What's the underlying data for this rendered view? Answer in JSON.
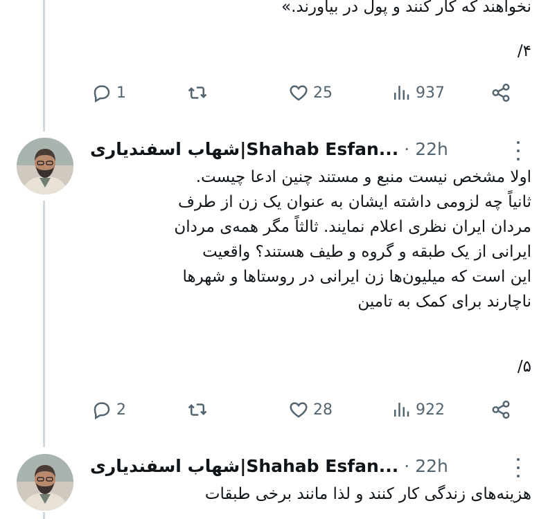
{
  "tweet1": {
    "text_fragment": "نخواهند که کار کنند و پول در بیاورند.»",
    "thread_number": "۴/",
    "replies": "1",
    "likes": "25",
    "views": "937"
  },
  "tweet2": {
    "author": "شهاب اسفندیاری|Shahab Esfan...",
    "time": "22h",
    "separator": "·",
    "lines": [
      "اولا مشخص نیست منبع و مستند چنین ادعا چیست.",
      "ثانیاً چه لزومی داشته ایشان به عنوان یک زن از طرف",
      "مردان ایران نظری اعلام نمایند. ثالثاً مگر همه‌ی مردان",
      "ایرانی از یک طبقه و گروه و طیف هستند؟ واقعیت",
      "این است که میلیون‌ها زن ایرانی در روستاها و شهرها",
      "ناچارند برای کمک به تامین"
    ],
    "thread_number": "۵/",
    "replies": "2",
    "likes": "28",
    "views": "922"
  },
  "tweet3": {
    "author": "شهاب اسفندیاری|Shahab Esfan...",
    "time": "22h",
    "separator": "·",
    "lines": [
      "هزینه‌های زندگی کار کنند و لذا مانند برخی طبقات"
    ]
  },
  "icons": {
    "reply": "reply-icon",
    "retweet": "retweet-icon",
    "like": "heart-icon",
    "views": "views-icon",
    "share": "share-icon",
    "more": "more-icon"
  },
  "colors": {
    "text": "#0f1419",
    "secondary": "#536471",
    "thread_line": "#cfd9de",
    "background": "#ffffff"
  }
}
